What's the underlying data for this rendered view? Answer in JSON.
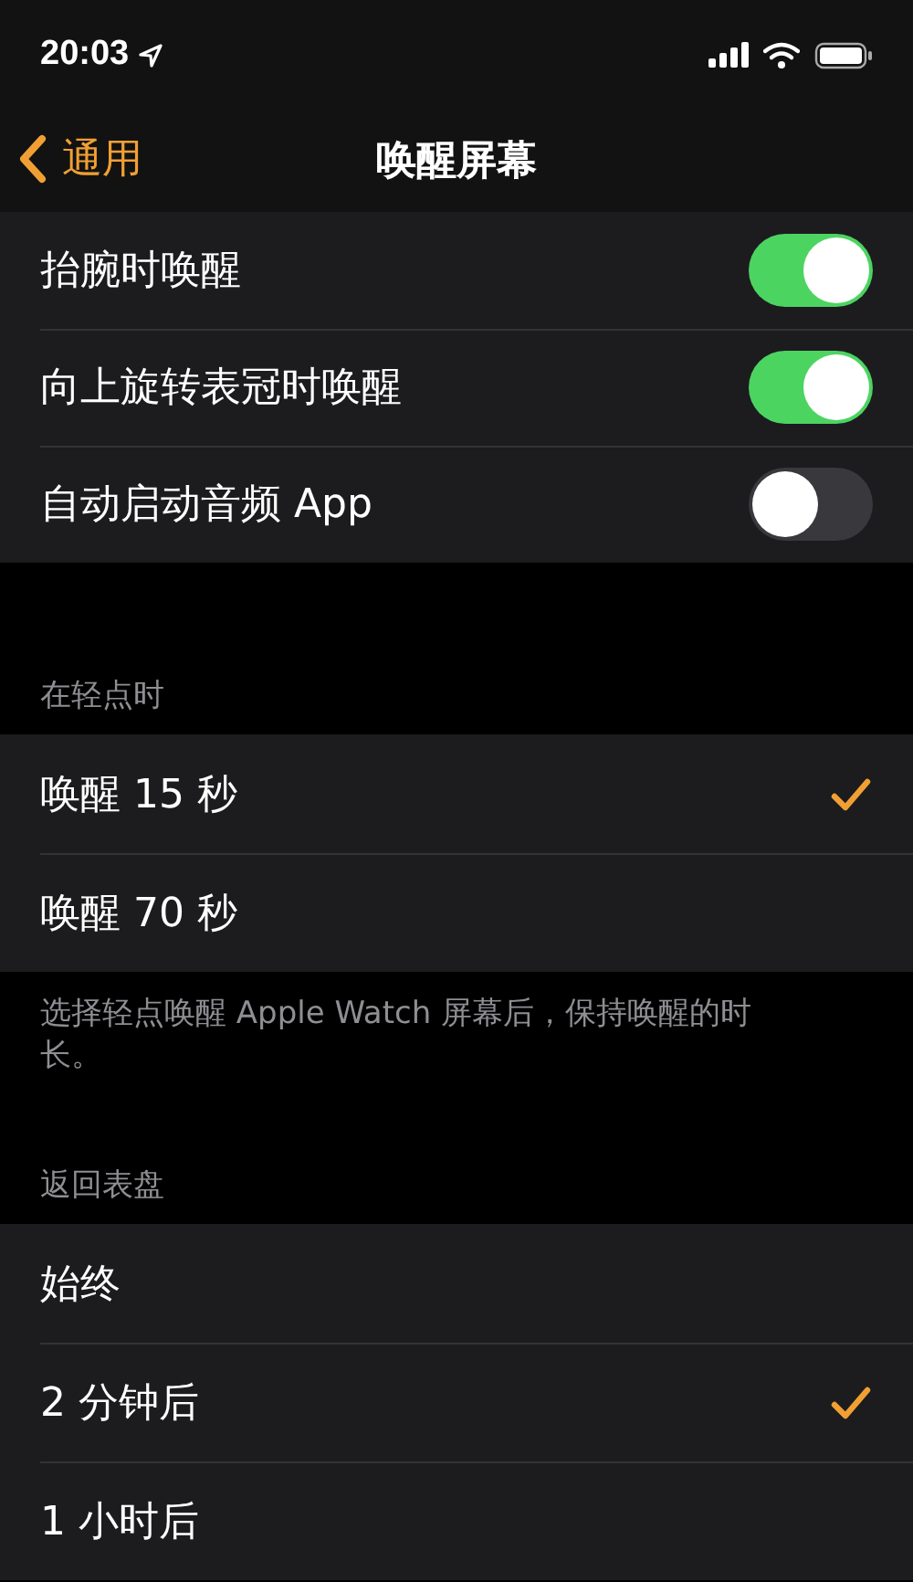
{
  "status_bar": {
    "time": "20:03"
  },
  "nav": {
    "back": "通用",
    "title": "唤醒屏幕"
  },
  "groups": [
    {
      "rows": [
        {
          "kind": "toggle",
          "label": "抬腕时唤醒",
          "on": true
        },
        {
          "kind": "toggle",
          "label": "向上旋转表冠时唤醒",
          "on": true
        },
        {
          "kind": "toggle",
          "label": "自动启动音频 App",
          "on": false
        }
      ]
    },
    {
      "header": "在轻点时",
      "footer": "选择轻点唤醒 Apple Watch 屏幕后，保持唤醒的时长。",
      "rows": [
        {
          "kind": "choice",
          "label": "唤醒 15 秒",
          "selected": true
        },
        {
          "kind": "choice",
          "label": "唤醒 70 秒",
          "selected": false
        }
      ]
    },
    {
      "header": "返回表盘",
      "rows": [
        {
          "kind": "choice",
          "label": "始终",
          "selected": false
        },
        {
          "kind": "choice",
          "label": "2 分钟后",
          "selected": true
        },
        {
          "kind": "choice",
          "label": "1 小时后",
          "selected": false
        }
      ]
    }
  ]
}
